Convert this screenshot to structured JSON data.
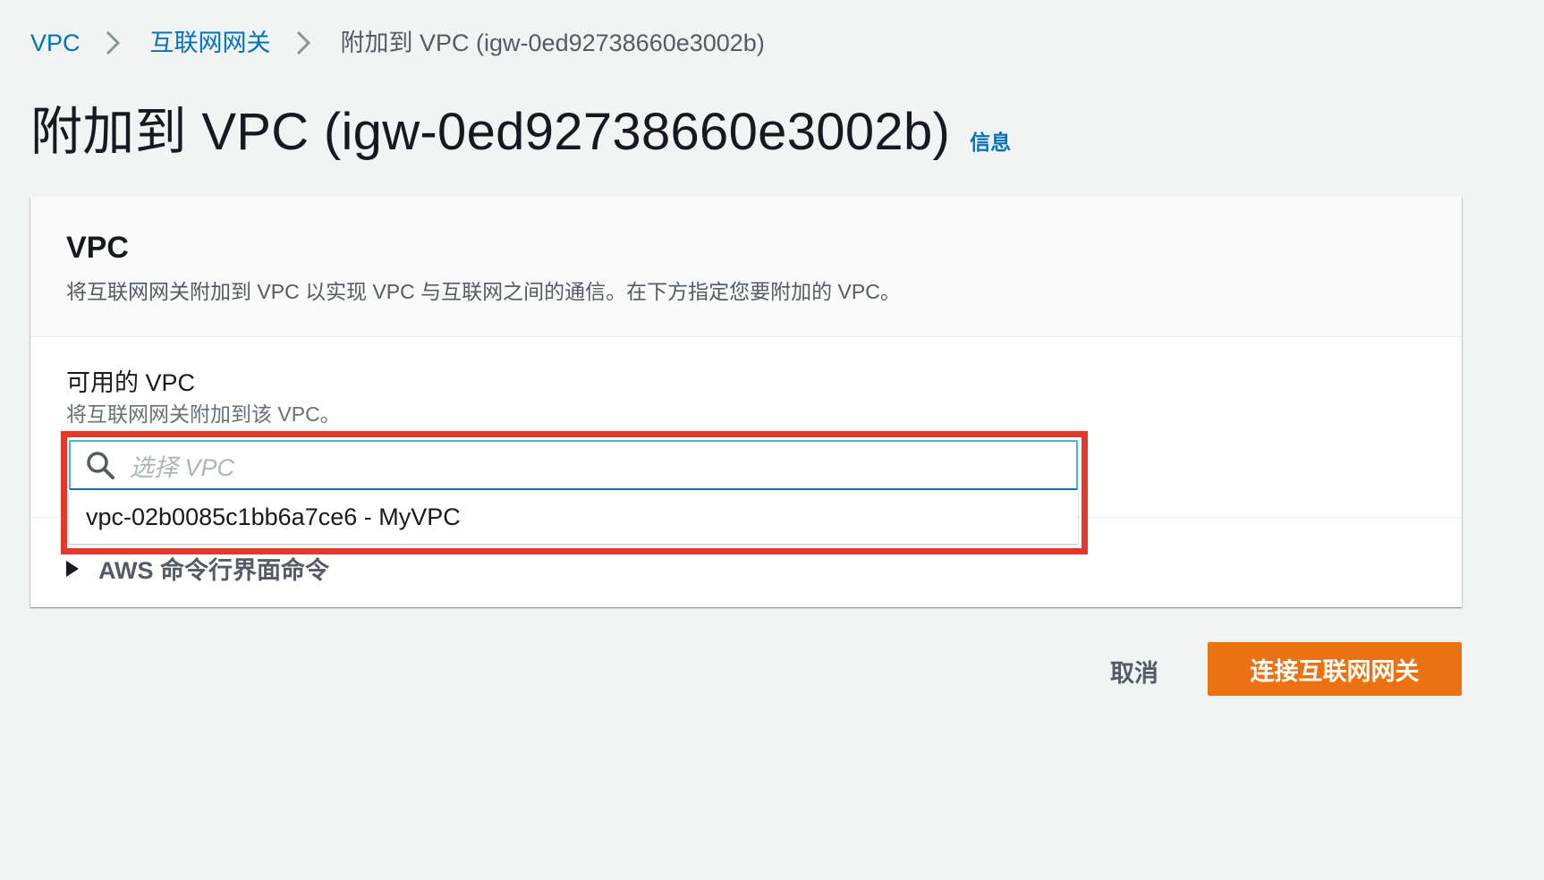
{
  "breadcrumb": {
    "items": [
      "VPC",
      "互联网网关"
    ],
    "current": "附加到 VPC (igw-0ed92738660e3002b)"
  },
  "header": {
    "title": "附加到 VPC (igw-0ed92738660e3002b)",
    "info_link": "信息"
  },
  "container": {
    "title": "VPC",
    "description": "将互联网网关附加到 VPC 以实现 VPC 与互联网之间的通信。在下方指定您要附加的 VPC。"
  },
  "field": {
    "label": "可用的 VPC",
    "description": "将互联网网关附加到该 VPC。",
    "placeholder": "选择 VPC",
    "options": [
      "vpc-02b0085c1bb6a7ce6 - MyVPC"
    ]
  },
  "expander": {
    "label": "AWS 命令行界面命令"
  },
  "actions": {
    "cancel_label": "取消",
    "submit_label": "连接互联网网关"
  },
  "colors": {
    "link": "#0073bb",
    "primary_button": "#ec7211",
    "highlight": "#e3392a",
    "focus_border": "#44b9d6"
  }
}
